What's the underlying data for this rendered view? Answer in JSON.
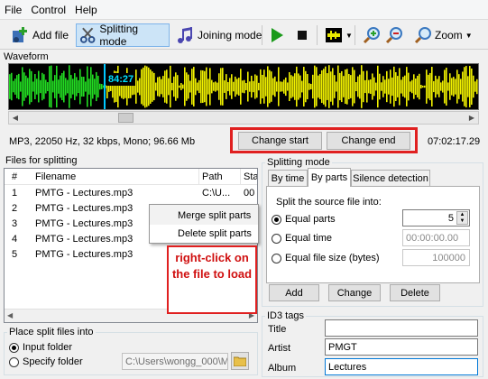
{
  "menu": [
    "File",
    "Control",
    "Help"
  ],
  "toolbar": {
    "add_file": "Add file",
    "splitting_mode": "Splitting mode",
    "joining_mode": "Joining mode",
    "zoom": "Zoom"
  },
  "waveform": {
    "label": "Waveform",
    "position_time": "84:27"
  },
  "info": {
    "format": "MP3, 22050 Hz, 32 kbps, Mono; 96.66 Mb",
    "duration": "07:02:17.29",
    "change_start": "Change start",
    "change_end": "Change end"
  },
  "files": {
    "label": "Files for splitting",
    "columns": [
      "#",
      "Filename",
      "Path",
      "Sta"
    ],
    "rows": [
      {
        "n": "1",
        "name": "PMTG - Lectures.mp3",
        "path": "C:\\U...",
        "status": "00"
      },
      {
        "n": "2",
        "name": "PMTG - Lectures.mp3",
        "path": "",
        "status": ""
      },
      {
        "n": "3",
        "name": "PMTG - Lectures.mp3",
        "path": "",
        "status": ""
      },
      {
        "n": "4",
        "name": "PMTG - Lectures.mp3",
        "path": "",
        "status": ""
      },
      {
        "n": "5",
        "name": "PMTG - Lectures.mp3",
        "path": "",
        "status": ""
      }
    ]
  },
  "context_menu": [
    "Merge split parts",
    "Delete split parts"
  ],
  "callout": "right-click on the file to load",
  "place": {
    "label": "Place split files into",
    "input_folder": "Input folder",
    "specify_folder": "Specify folder",
    "path": "C:\\Users\\wongg_000\\Mus"
  },
  "splitting": {
    "label": "Splitting mode",
    "tabs": [
      "By time",
      "By parts",
      "Silence detection"
    ],
    "split_into": "Split the source file into:",
    "equal_parts": "Equal parts",
    "parts_value": "5",
    "equal_time": "Equal time",
    "time_value": "00:00:00.00",
    "equal_size": "Equal file size (bytes)",
    "size_value": "100000",
    "add": "Add",
    "change": "Change",
    "delete": "Delete"
  },
  "id3": {
    "label": "ID3 tags",
    "title_label": "Title",
    "title_value": "",
    "artist_label": "Artist",
    "artist_value": "PMGT",
    "album_label": "Album",
    "album_value": "Lectures"
  }
}
